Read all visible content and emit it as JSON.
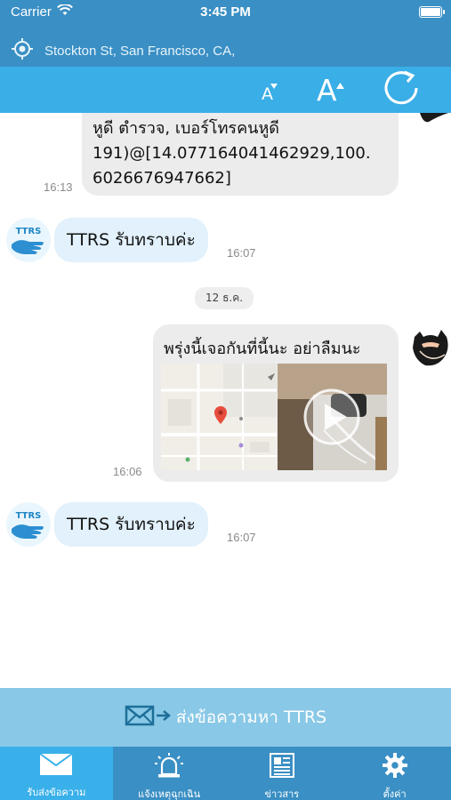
{
  "status_bar": {
    "carrier": "Carrier",
    "time": "3:45 PM"
  },
  "location": {
    "text": "Stockton St, San Francisco, CA,"
  },
  "toolbar": {
    "decrease_font_label": "A",
    "increase_font_label": "A",
    "icons": [
      "font-decrease-icon",
      "font-increase-icon",
      "refresh-icon"
    ]
  },
  "messages": {
    "m1": {
      "lines": [
        "หูดี ตำรวจ, เบอร์โทรคนหูดี",
        "191)@[14.077164041462929,100.",
        "6026676947662]"
      ],
      "time": "16:13"
    },
    "m2": {
      "text": "TTRS รับทราบค่ะ",
      "time": "16:07"
    },
    "date_divider": "12 ธ.ค.",
    "m3": {
      "text": "พรุ่งนี้เจอกันที่นี้นะ อย่าลืมนะ",
      "time": "16:06"
    },
    "m4": {
      "text": "TTRS รับทราบค่ะ",
      "time": "16:07"
    },
    "ttrs_avatar_text": "TTRS"
  },
  "send_bar": {
    "label": "ส่งข้อความหา TTRS",
    "icon": "mail-arrow-icon"
  },
  "tabs": [
    {
      "label": "รับส่งข้อความ",
      "icon": "mail-icon",
      "active": true
    },
    {
      "label": "แจ้งเหตุฉุกเฉิน",
      "icon": "siren-icon",
      "active": false
    },
    {
      "label": "ข่าวสาร",
      "icon": "news-icon",
      "active": false
    },
    {
      "label": "ตั้งค่า",
      "icon": "gear-icon",
      "active": false
    }
  ],
  "colors": {
    "header": "#3a8fc4",
    "toolbar": "#3aaee6",
    "incoming_bubble": "#e2f1fb",
    "outgoing_bubble": "#ececec",
    "send_bar": "#89c8e6",
    "active_tab": "#39b0ea"
  }
}
